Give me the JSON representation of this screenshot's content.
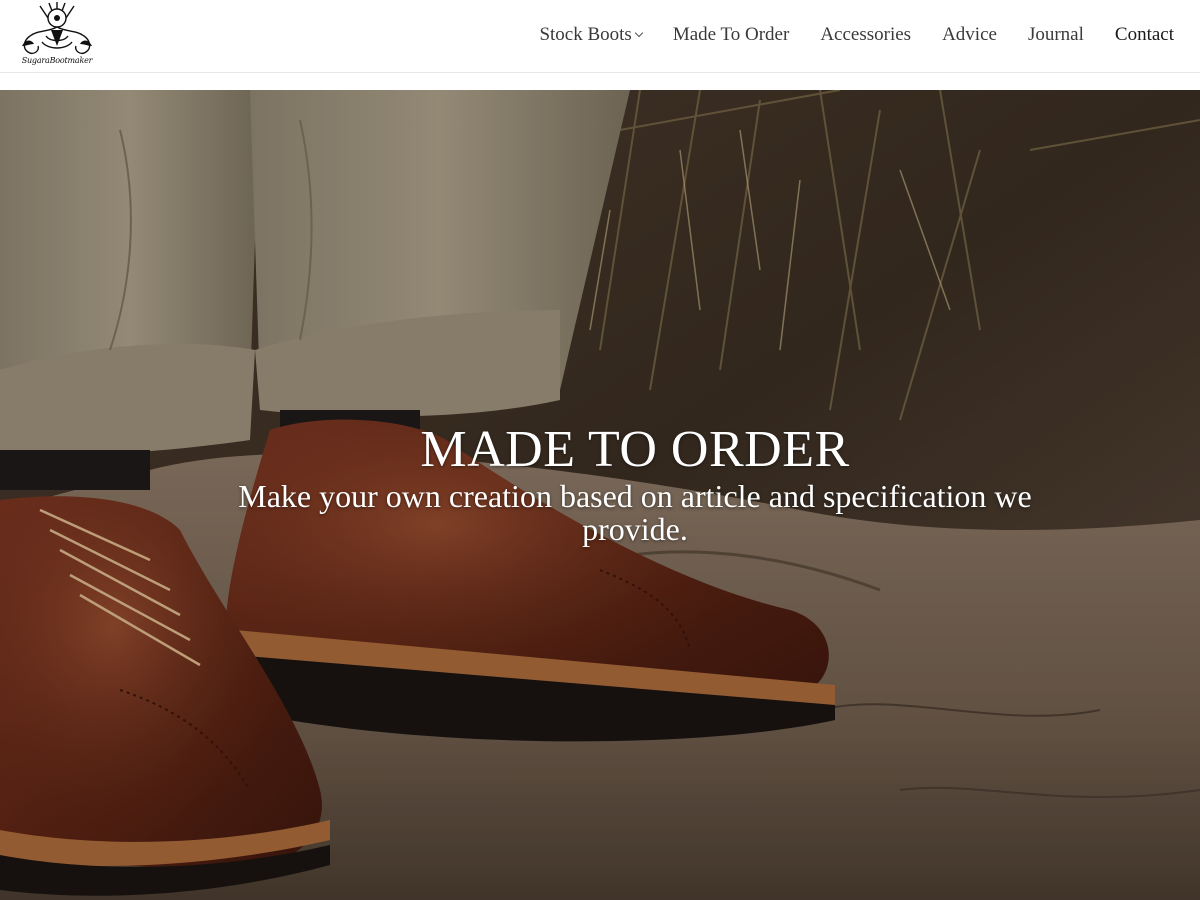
{
  "brand": {
    "logo_text": "SugaraBootmaker"
  },
  "nav": {
    "items": [
      {
        "label": "Stock Boots"
      },
      {
        "label": "Made To Order"
      },
      {
        "label": "Accessories"
      },
      {
        "label": "Advice"
      },
      {
        "label": "Journal"
      },
      {
        "label": "Contact"
      }
    ]
  },
  "hero": {
    "title": "MADE TO ORDER",
    "subtitle": "Make your own creation based on article and specification we provide."
  },
  "icons": {
    "logo": "eagle-crest-logo-icon",
    "dropdown": "chevron-down-icon"
  },
  "colors": {
    "nav_text": "#3a3a3a",
    "hero_text": "#ffffff",
    "leather": "#6b2a16"
  }
}
